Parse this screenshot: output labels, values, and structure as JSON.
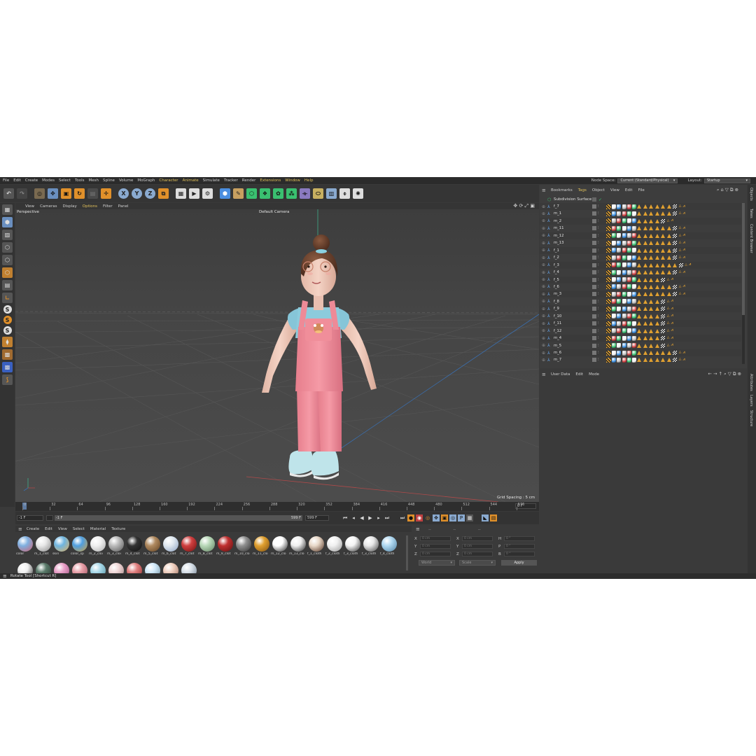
{
  "menubar": {
    "items": [
      "File",
      "Edit",
      "Create",
      "Modes",
      "Select",
      "Tools",
      "Mesh",
      "Spline",
      "Volume",
      "MoGraph",
      "Character",
      "Animate",
      "Simulate",
      "Tracker",
      "Render",
      "Extensions",
      "Window",
      "Help"
    ],
    "node_space_label": "Node Space:",
    "node_space_value": "Current (Standard/Physical)",
    "layout_label": "Layout:",
    "layout_value": "Startup"
  },
  "toolbar": {
    "icons": [
      "undo-icon",
      "redo-icon",
      "live-selection-icon",
      "move-icon",
      "scale-icon",
      "rotate-icon",
      "recent-tool-icon",
      "transform-icon",
      "x-axis-icon",
      "y-axis-icon",
      "z-axis-icon",
      "coordinate-system-icon",
      "render-region-icon",
      "render-view-icon",
      "render-settings-icon",
      "cube-icon",
      "pen-icon",
      "subdivision-icon",
      "array-icon",
      "mograph-cloner-icon",
      "fracture-icon",
      "deformer-icon",
      "floor-icon",
      "camera-icon",
      "light-icon"
    ],
    "axis_labels": [
      "X",
      "Y",
      "Z"
    ]
  },
  "viewport": {
    "menu": [
      "View",
      "Cameras",
      "Display",
      "Options",
      "Filter",
      "Panel"
    ],
    "mode": "Perspective",
    "camera": "Default Camera",
    "grid_spacing": "Grid Spacing : 5 cm"
  },
  "timeline": {
    "ticks": [
      "0",
      "32",
      "64",
      "96",
      "128",
      "160",
      "192",
      "224",
      "256",
      "288",
      "320",
      "352",
      "384",
      "416",
      "448",
      "480",
      "512",
      "544",
      "576"
    ],
    "current_frame": "0 F",
    "start_field": "-1 F",
    "start_field2": "-1 F",
    "end_field": "599 F",
    "end_field2": "599 F"
  },
  "material_manager": {
    "menu": [
      "Create",
      "Edit",
      "View",
      "Select",
      "Material",
      "Texture"
    ],
    "row1": [
      {
        "label": "color",
        "c1": "#7fb0e0",
        "c2": "#d06070"
      },
      {
        "label": "m_1_clot",
        "c1": "#e8e8e8",
        "c2": "#888"
      },
      {
        "label": "skin",
        "c1": "#6fb5e0",
        "c2": "#e0b060"
      },
      {
        "label": "color_sp",
        "c1": "#4f9fe0",
        "c2": "#d0a040"
      },
      {
        "label": "m_2_cloi",
        "c1": "#f0f0f0",
        "c2": "#aaa"
      },
      {
        "label": "m_3_cloi",
        "c1": "#bbbbbb",
        "c2": "#555"
      },
      {
        "label": "m_4_clot",
        "c1": "#333",
        "c2": "#111"
      },
      {
        "label": "m_5_clot",
        "c1": "#b08a60",
        "c2": "#604020"
      },
      {
        "label": "m_6_clot",
        "c1": "#e0e8f0",
        "c2": "#8aa0c0"
      },
      {
        "label": "m_7_clot",
        "c1": "#d04040",
        "c2": "#701010"
      },
      {
        "label": "m_8_clot",
        "c1": "#b8d8b8",
        "c2": "#608060"
      },
      {
        "label": "m_9_clot",
        "c1": "#c03030",
        "c2": "#601010"
      },
      {
        "label": "m_10_clo",
        "c1": "#909090",
        "c2": "#303030"
      },
      {
        "label": "m_11_clo",
        "c1": "#e0a030",
        "c2": "#805010"
      },
      {
        "label": "m_12_clo",
        "c1": "#ffffff",
        "c2": "#222"
      },
      {
        "label": "m_13_clo",
        "c1": "#f0f0f0",
        "c2": "#222"
      },
      {
        "label": "f_1_cloth",
        "c1": "#e8d8c8",
        "c2": "#503020"
      },
      {
        "label": "f_2_cloth",
        "c1": "#f0f0f0",
        "c2": "#999"
      },
      {
        "label": "f_3_cloth",
        "c1": "#f4f4f4",
        "c2": "#333"
      },
      {
        "label": "f_3_cloth",
        "c1": "#e8e8e8",
        "c2": "#444"
      },
      {
        "label": "f_4_cloth",
        "c1": "#b0d8f0",
        "c2": "#5080a0"
      }
    ],
    "row2": [
      {
        "c1": "#f0f0f0",
        "c2": "#333"
      },
      {
        "c1": "#5a7a6a",
        "c2": "#2a3a30"
      },
      {
        "c1": "#e8a0c8",
        "c2": "#a05080"
      },
      {
        "c1": "#e8a0a8",
        "c2": "#a05060"
      },
      {
        "c1": "#a8d8e8",
        "c2": "#5090a0"
      },
      {
        "c1": "#f0d8d8",
        "c2": "#a08080"
      },
      {
        "c1": "#e08080",
        "c2": "#903030"
      },
      {
        "c1": "#d0e8f8",
        "c2": "#7090a0"
      },
      {
        "c1": "#f0d0c0",
        "c2": "#a07060"
      },
      {
        "c1": "#d8e0e8",
        "c2": "#708090"
      }
    ]
  },
  "coordinates": {
    "rows": [
      {
        "a": "X",
        "av": "0 cm",
        "b": "X",
        "bv": "0 cm",
        "c": "H",
        "cv": "0 °"
      },
      {
        "a": "Y",
        "av": "0 cm",
        "b": "Y",
        "bv": "0 cm",
        "c": "P",
        "cv": "0 °"
      },
      {
        "a": "Z",
        "av": "0 cm",
        "b": "Z",
        "bv": "0 cm",
        "c": "B",
        "cv": "0 °"
      }
    ],
    "world": "World",
    "scale": "Scale",
    "apply": "Apply"
  },
  "status": {
    "text": "Rotate Tool [Shortcut R]"
  },
  "object_manager": {
    "menu": [
      "File",
      "Edit",
      "View",
      "Object",
      "Tags",
      "Bookmarks"
    ],
    "root": "Subdivision Surface",
    "objects": [
      {
        "name": "f_7",
        "tri": 6
      },
      {
        "name": "m_1",
        "tri": 6
      },
      {
        "name": "m_2",
        "tri": 4
      },
      {
        "name": "m_11",
        "tri": 6
      },
      {
        "name": "m_12",
        "tri": 6
      },
      {
        "name": "m_13",
        "tri": 6
      },
      {
        "name": "f_1",
        "tri": 6
      },
      {
        "name": "f_2",
        "tri": 6
      },
      {
        "name": "f_3",
        "tri": 7
      },
      {
        "name": "f_4",
        "tri": 6
      },
      {
        "name": "f_5",
        "tri": 4
      },
      {
        "name": "f_6",
        "tri": 6
      },
      {
        "name": "m_3",
        "tri": 6
      },
      {
        "name": "f_8",
        "tri": 4
      },
      {
        "name": "f_9",
        "tri": 4
      },
      {
        "name": "f_10",
        "tri": 4
      },
      {
        "name": "f_11",
        "tri": 4
      },
      {
        "name": "f_12",
        "tri": 4
      },
      {
        "name": "m_4",
        "tri": 4
      },
      {
        "name": "m_5",
        "tri": 4
      },
      {
        "name": "m_6",
        "tri": 6
      },
      {
        "name": "m_7",
        "tri": 6
      }
    ]
  },
  "attributes": {
    "menu": [
      "Mode",
      "Edit",
      "User Data"
    ]
  },
  "side_tabs": [
    "Objects",
    "Takes",
    "Content Browser",
    "Attributes",
    "Layers",
    "Structure"
  ]
}
